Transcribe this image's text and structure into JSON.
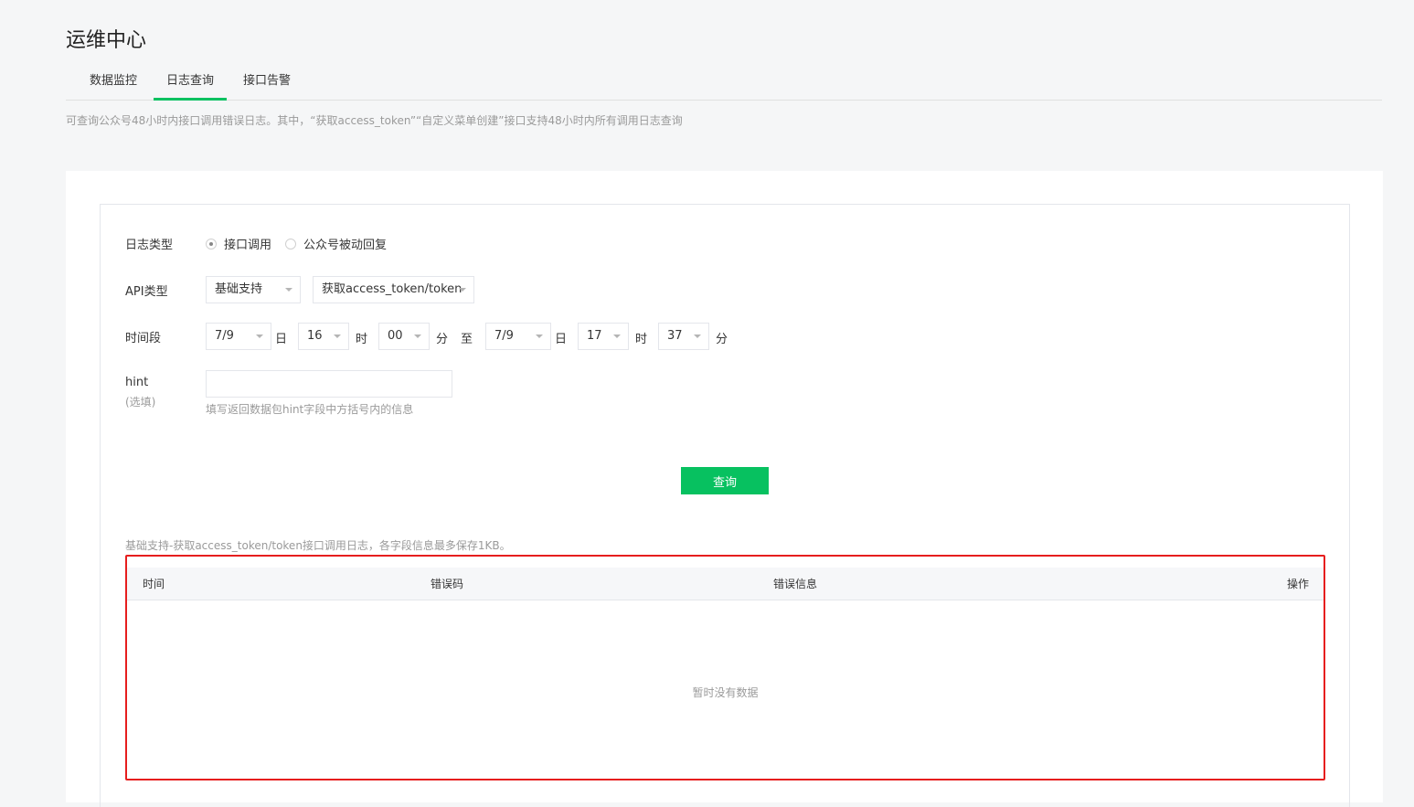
{
  "page": {
    "title": "运维中心",
    "description": "可查询公众号48小时内接口调用错误日志。其中，“获取access_token”“自定义菜单创建”接口支持48小时内所有调用日志查询"
  },
  "tabs": [
    {
      "label": "数据监控",
      "active": false
    },
    {
      "label": "日志查询",
      "active": true
    },
    {
      "label": "接口告警",
      "active": false
    }
  ],
  "form": {
    "log_type": {
      "label": "日志类型",
      "options": [
        {
          "label": "接口调用",
          "checked": true
        },
        {
          "label": "公众号被动回复",
          "checked": false
        }
      ]
    },
    "api_type": {
      "label": "API类型",
      "category": "基础支持",
      "api": "获取access_token/token"
    },
    "time_range": {
      "label": "时间段",
      "start": {
        "date": "7/9",
        "hour": "16",
        "minute": "00"
      },
      "end": {
        "date": "7/9",
        "hour": "17",
        "minute": "37"
      },
      "unit_day": "日",
      "unit_hour": "时",
      "unit_minute": "分",
      "to": "至"
    },
    "hint": {
      "label": "hint",
      "sub_label": "(选填)",
      "value": "",
      "tip": "填写返回数据包hint字段中方括号内的信息"
    },
    "query_button": "查询"
  },
  "results": {
    "note": "基础支持-获取access_token/token接口调用日志，各字段信息最多保存1KB。",
    "columns": [
      "时间",
      "错误码",
      "错误信息",
      "操作"
    ],
    "empty_text": "暂时没有数据"
  },
  "colors": {
    "accent": "#07c160",
    "highlight_border": "#e61e1e"
  }
}
